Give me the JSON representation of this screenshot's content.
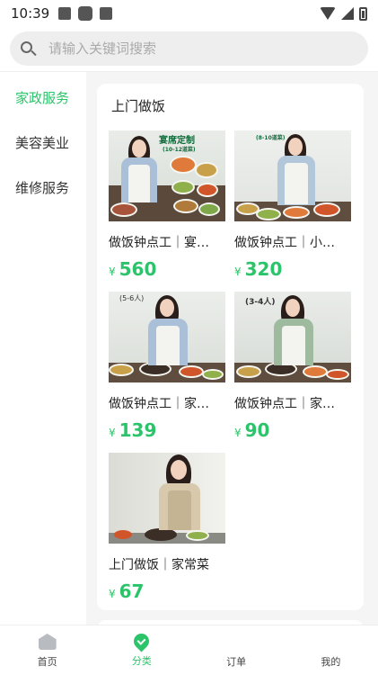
{
  "status_bar": {
    "time": "10:39"
  },
  "search": {
    "placeholder": "请输入关键词搜索"
  },
  "sidebar": {
    "items": [
      {
        "label": "家政服务",
        "active": true
      },
      {
        "label": "美容美业",
        "active": false
      },
      {
        "label": "维修服务",
        "active": false
      }
    ]
  },
  "section": {
    "title": "上门做饭",
    "products": [
      {
        "title": "做饭钟点工｜宴席定制",
        "currency": "¥",
        "price": "560",
        "banner": "宴席定制",
        "banner_sub": "(10-12道菜)"
      },
      {
        "title": "做饭钟点工｜小型聚餐",
        "currency": "¥",
        "price": "320",
        "banner": "(8-10道菜)"
      },
      {
        "title": "做饭钟点工｜家常菜",
        "currency": "¥",
        "price": "139",
        "banner": "(5-6人)"
      },
      {
        "title": "做饭钟点工｜家常菜",
        "currency": "¥",
        "price": "90",
        "banner": "(3-4人)"
      },
      {
        "title": "上门做饭｜家常菜",
        "currency": "¥",
        "price": "67"
      }
    ]
  },
  "tabbar": {
    "tabs": [
      {
        "label": "首页",
        "icon": "home-icon",
        "active": false
      },
      {
        "label": "分类",
        "icon": "category-tag-icon",
        "active": true
      },
      {
        "label": "订单",
        "icon": "order-icon",
        "active": false
      },
      {
        "label": "我的",
        "icon": "profile-icon",
        "active": false
      }
    ]
  },
  "colors": {
    "accent": "#2cc46b",
    "background": "#f5f5f5"
  }
}
